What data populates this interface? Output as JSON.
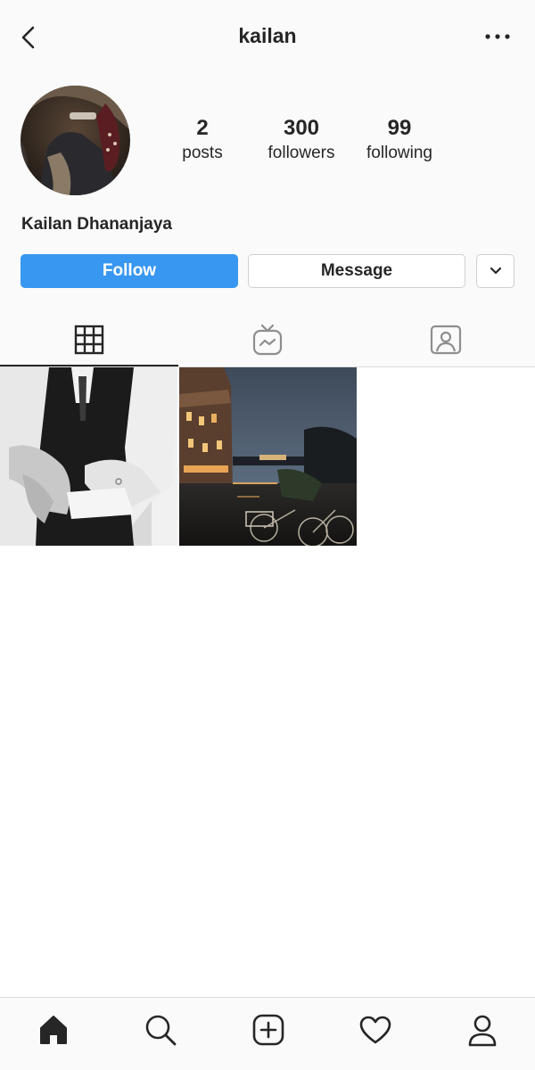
{
  "header": {
    "username": "kailan"
  },
  "profile": {
    "full_name": "Kailan Dhananjaya",
    "stats": [
      {
        "value": "2",
        "label": "posts"
      },
      {
        "value": "300",
        "label": "followers"
      },
      {
        "value": "99",
        "label": "following"
      }
    ]
  },
  "actions": {
    "follow_label": "Follow",
    "message_label": "Message"
  },
  "tabs": [
    {
      "name": "grid-icon",
      "active": true
    },
    {
      "name": "igtv-icon",
      "active": false
    },
    {
      "name": "tagged-icon",
      "active": false
    }
  ],
  "bottom_nav": [
    "home-icon",
    "search-icon",
    "add-post-icon",
    "heart-icon",
    "profile-icon"
  ],
  "colors": {
    "accent": "#3897f0",
    "text": "#262626",
    "border": "#dbdbdb"
  }
}
